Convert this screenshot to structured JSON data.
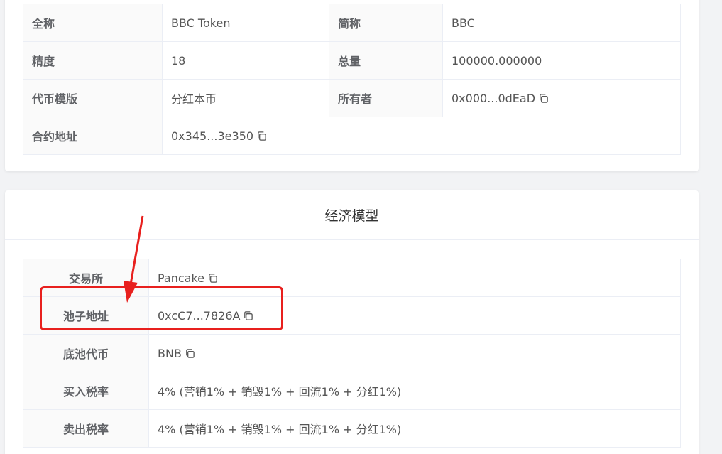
{
  "token_info": {
    "rows": [
      {
        "label1": "全称",
        "value1": "BBC Token",
        "label2": "简称",
        "value2": "BBC"
      },
      {
        "label1": "精度",
        "value1": "18",
        "label2": "总量",
        "value2": "100000.000000"
      },
      {
        "label1": "代币模版",
        "value1": "分红本币",
        "label2": "所有者",
        "value2": "0x000...0dEaD"
      },
      {
        "label1": "合约地址",
        "value1": "0x345...3e350"
      }
    ]
  },
  "economic_model": {
    "title": "经济模型",
    "rows": [
      {
        "label": "交易所",
        "value": "Pancake"
      },
      {
        "label": "池子地址",
        "value": "0xcC7...7826A"
      },
      {
        "label": "底池代币",
        "value": "BNB"
      },
      {
        "label": "买入税率",
        "value": "4% (营销1% + 销毁1% + 回流1% + 分红1%)"
      },
      {
        "label": "卖出税率",
        "value": "4% (营销1% + 销毁1% + 回流1% + 分红1%)"
      }
    ]
  },
  "annotation": {
    "color": "#e8201e"
  },
  "icons": {
    "copy": "copy-icon"
  }
}
